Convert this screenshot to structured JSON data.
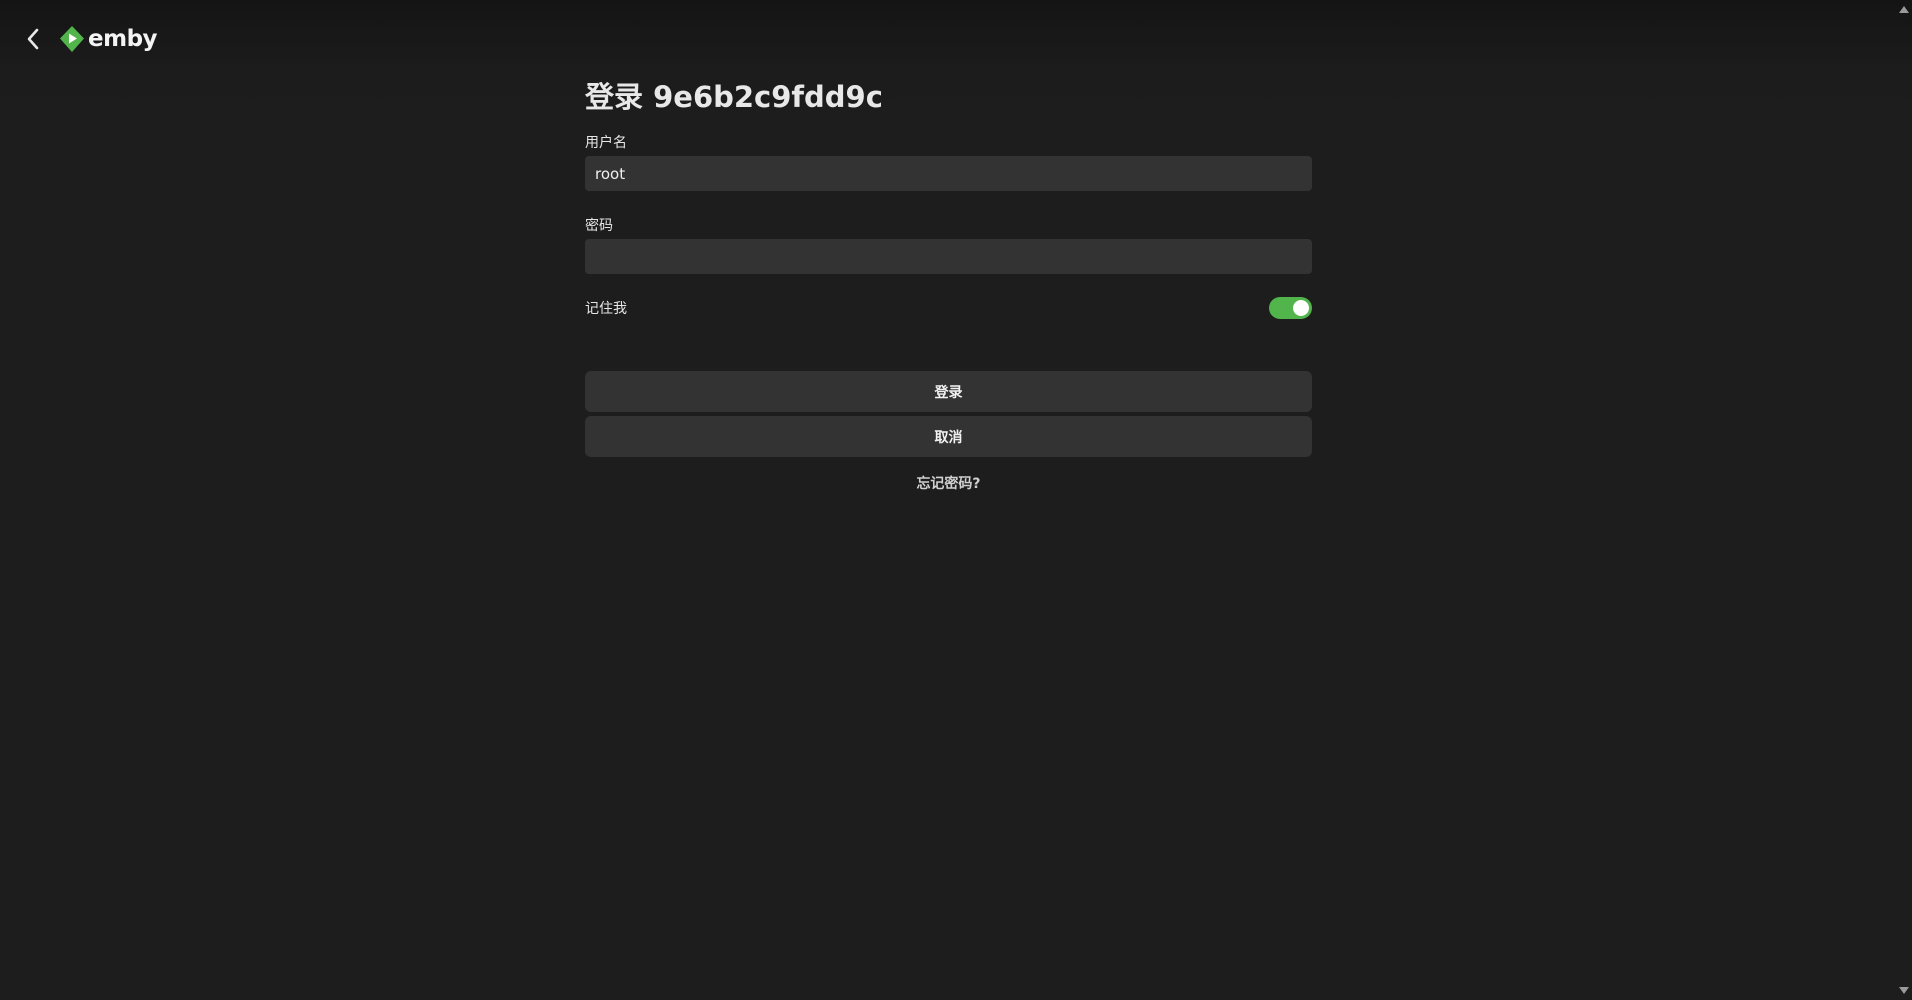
{
  "header": {
    "brand_name": "emby",
    "brand_color": "#52b54b",
    "back_icon": "chevron-left-icon",
    "logo_icon": "emby-play-diamond-icon"
  },
  "login": {
    "title": "登录 9e6b2c9fdd9c",
    "username_label": "用户名",
    "username_value": "root",
    "password_label": "密码",
    "password_value": "",
    "remember_label": "记住我",
    "remember_checked": true,
    "login_button": "登录",
    "cancel_button": "取消",
    "forgot_link": "忘记密码?"
  },
  "colors": {
    "background": "#1d1d1d",
    "input_background": "#333333",
    "accent": "#52b54b"
  }
}
